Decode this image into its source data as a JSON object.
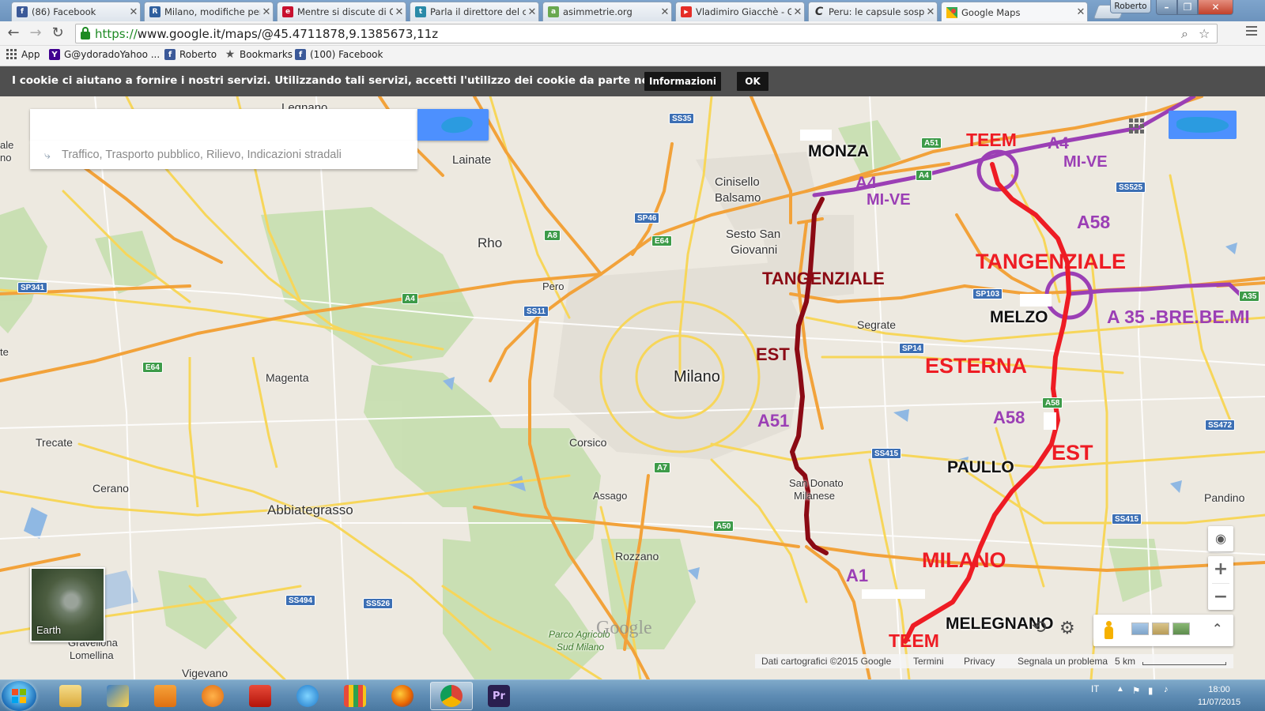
{
  "browser": {
    "tabs": [
      {
        "title": "(86) Facebook",
        "icon": "facebook-icon",
        "color": "#3b5998",
        "glyph": "f"
      },
      {
        "title": "Milano, modifiche per",
        "icon": "repubblica-icon",
        "color": "#2f5f9e",
        "glyph": "R"
      },
      {
        "title": "Mentre si discute di G",
        "icon": "site-icon",
        "color": "#c8102e",
        "glyph": "e"
      },
      {
        "title": "Parla il direttore del c",
        "icon": "blog-icon",
        "color": "#2a8aa8",
        "glyph": "t"
      },
      {
        "title": "asimmetrie.org",
        "icon": "asimmetrie-icon",
        "color": "#6aa84f",
        "glyph": "a"
      },
      {
        "title": "Vladimiro Giacchè - G",
        "icon": "youtube-icon",
        "color": "#e52d27",
        "glyph": "▶"
      },
      {
        "title": "Peru: le capsule sospe",
        "icon": "c-icon",
        "color": "#444444",
        "glyph": "C"
      },
      {
        "title": "Google Maps",
        "icon": "google-maps-icon",
        "color": "#34a853",
        "glyph": "M"
      }
    ],
    "profile_name": "Roberto",
    "url_https": "https://",
    "url_rest": "www.google.it/maps/@45.4711878,9.1385673,11z",
    "bookmarks": [
      {
        "label": "App",
        "icon": "apps-grid-icon"
      },
      {
        "label": "G@ydoradoYahoo ...",
        "icon": "yahoo-icon"
      },
      {
        "label": "Roberto",
        "icon": "facebook-icon"
      },
      {
        "label": "Bookmarks",
        "icon": "star-icon"
      },
      {
        "label": "(100) Facebook",
        "icon": "facebook-icon"
      }
    ]
  },
  "cookie_bar": {
    "text": "I cookie ci aiutano a fornire i nostri servizi. Utilizzando tali servizi, accetti l'utilizzo dei cookie da parte nostra.",
    "info_label": "Informazioni",
    "ok_label": "OK"
  },
  "maps": {
    "search_placeholder": "",
    "directions_hint": "Traffico, Trasporto pubblico, Rilievo, Indicazioni stradali",
    "earth_label": "Earth",
    "logo_text": "Google",
    "footer": {
      "data_credit": "Dati cartografici ©2015 Google",
      "terms": "Termini",
      "privacy": "Privacy",
      "report": "Segnala un problema",
      "scale": "5 km"
    }
  },
  "map_labels": {
    "legnano": "Legnano",
    "lainate": "Lainate",
    "cinisello": "Cinisello",
    "balsamo": "Balsamo",
    "monza": "MONZA",
    "rho": "Rho",
    "pero": "Pero",
    "sesto1": "Sesto San",
    "sesto2": "Giovanni",
    "segrate": "Segrate",
    "melzo": "MELZO",
    "milano": "Milano",
    "magenta": "Magenta",
    "trecate": "Trecate",
    "corsico": "Corsico",
    "cerano": "Cerano",
    "abbiategrasso": "Abbiategrasso",
    "assago": "Assago",
    "sandonato1": "San Donato",
    "sandonato2": "Milanese",
    "paullo": "PAULLO",
    "pandino": "Pandino",
    "rozzano": "Rozzano",
    "melegnano": "MELEGNANO",
    "gravellona1": "Gravellona",
    "gravellona2": "Lomellina",
    "vigevano": "Vigevano",
    "parco1": "Parco Agricolo",
    "parco2": "Sud Milano",
    "edge_ale": "ale",
    "edge_no": "no",
    "edge_te": "te"
  },
  "shields": {
    "ss35": "SS35",
    "a51": "A51",
    "a4a": "A4",
    "sp46": "SP46",
    "a8": "A8",
    "e64a": "E64",
    "ss525": "SS525",
    "sp341": "SP341",
    "a4b": "A4",
    "ss11": "SS11",
    "sp103": "SP103",
    "a35": "A35",
    "sp14": "SP14",
    "e64b": "E64",
    "a58": "A58",
    "ss415a": "SS415",
    "ss472": "SS472",
    "a7": "A7",
    "a50": "A50",
    "ss415b": "SS415",
    "ss494": "SS494",
    "ss526": "SS526"
  },
  "annotations": {
    "teem_top": "TEEM",
    "a4_right": "A4",
    "mive_right": "MI-VE",
    "a4_left": "A4",
    "mive_left": "MI-VE",
    "a58_top": "A58",
    "tang_ext_top": "TANGENZIALE",
    "a35": "A 35 -BRE.BE.MI",
    "tang_est_word": "TANGENZIALE",
    "est_left": "EST",
    "esterna": "ESTERNA",
    "a51": "A51",
    "a58_mid": "A58",
    "est_right": "EST",
    "milano_red": "MILANO",
    "a1": "A1",
    "teem_bottom": "TEEM"
  },
  "annotation_colors": {
    "red": "#ee1c24",
    "darkred": "#8b0a14",
    "purple": "#9b3fb5"
  },
  "taskbar": {
    "apps": [
      "explorer-icon",
      "paint-icon",
      "outlook-icon",
      "media-player-icon",
      "acrobat-icon",
      "internet-explorer-icon",
      "app-grid-icon",
      "firefox-icon",
      "chrome-icon",
      "premiere-icon"
    ],
    "language": "IT",
    "time": "18:00",
    "date": "11/07/2015"
  }
}
